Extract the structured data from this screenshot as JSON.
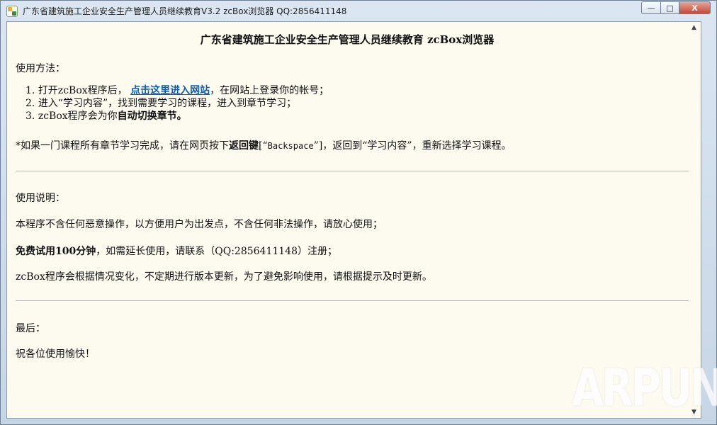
{
  "window": {
    "title": "广东省建筑施工企业安全生产管理人员继续教育V3.2 zcBox浏览器 QQ:2856411148",
    "controls": {
      "minimize": "—",
      "maximize": "□",
      "close": "X"
    }
  },
  "page": {
    "heading": "广东省建筑施工企业安全生产管理人员继续教育 zcBox浏览器",
    "usage_title": "使用方法：",
    "steps": [
      {
        "num": "1.",
        "pre": "打开zcBox程序后，",
        "link": "点击这里进入网站",
        "post": "，在网站上登录你的帐号；"
      },
      {
        "num": "2.",
        "text": "进入“学习内容”，找到需要学习的课程，进入到章节学习；"
      },
      {
        "num": "3.",
        "pre": "zcBox程序会为你",
        "bold": "自动切换章节。"
      }
    ],
    "note": {
      "pre": "*如果一门课程所有章节学习完成，请在网页按下",
      "bold": "返回键",
      "bracket_open": "[“",
      "key": "Backspace",
      "post": "”]，返回到“学习内容”，重新选择学习课程。"
    },
    "instructions_title": "使用说明：",
    "instructions": [
      "本程序不含任何恶意操作，以方便用户为出发点，不含任何非法操作，请放心使用；",
      "zcBox程序会根据情况变化，不定期进行版本更新，为了避免影响使用，请根据提示及时更新。"
    ],
    "trial": {
      "bold": "免费试用100分钟",
      "rest": "，如需延长使用，请联系（QQ:2856411148）注册；"
    },
    "final_title": "最后：",
    "final_text": "祝各位使用愉快！"
  },
  "scrollbar": {
    "up_arrow": "▲",
    "down_arrow": "▼"
  },
  "watermark": "ARPUN"
}
